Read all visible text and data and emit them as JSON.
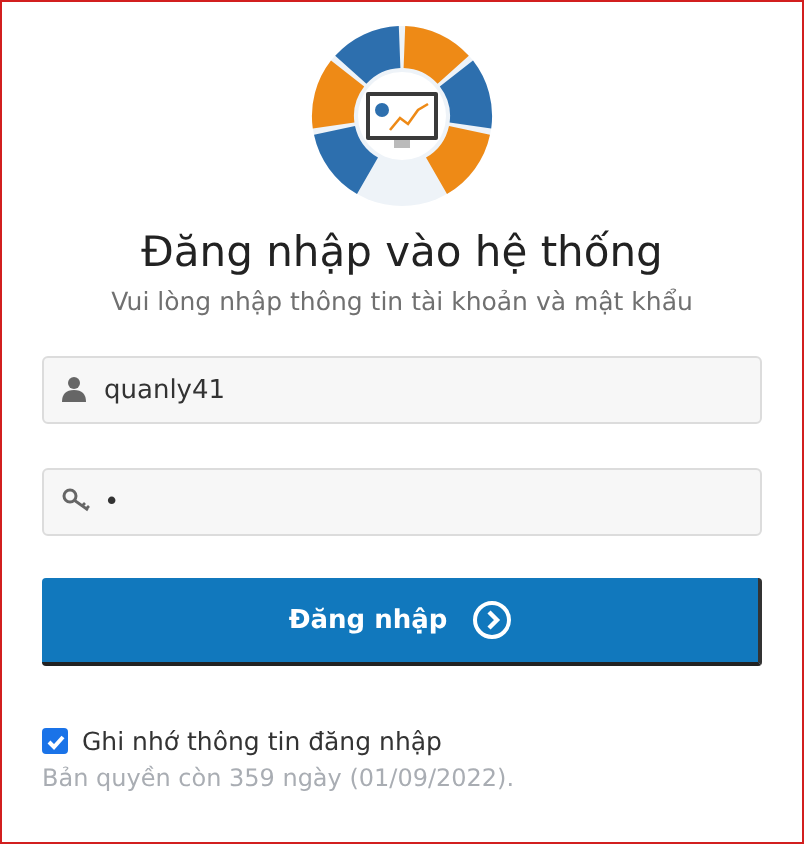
{
  "title": "Đăng nhập vào hệ thống",
  "subtitle": "Vui lòng nhập thông tin tài khoản và mật khẩu",
  "username": {
    "value": "quanly41"
  },
  "password": {
    "value": "•"
  },
  "login_button": {
    "label": "Đăng nhập"
  },
  "remember": {
    "label": "Ghi nhớ thông tin đăng nhập",
    "checked": true
  },
  "license": "Bản quyền còn 359 ngày (01/09/2022)."
}
